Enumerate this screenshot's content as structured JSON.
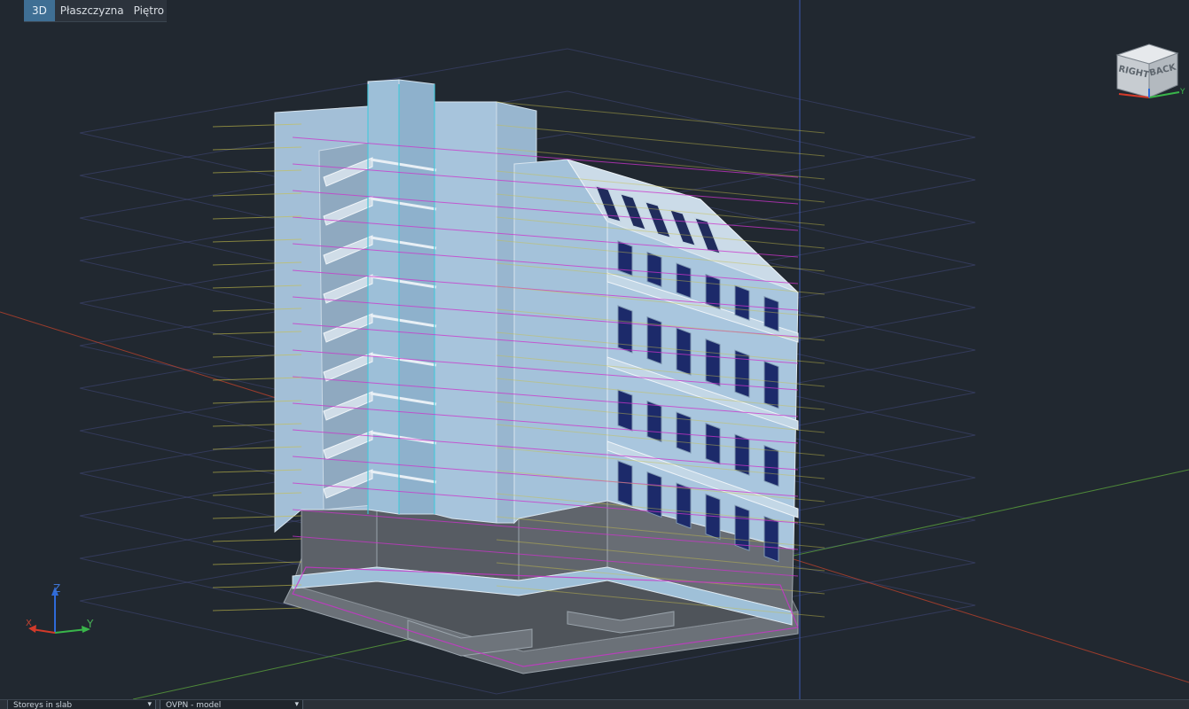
{
  "toolbar": {
    "view_3d": "3D",
    "plane": "Płaszczyzna",
    "floor": "Piętro"
  },
  "viewcube": {
    "face_right": "RIGHT",
    "face_back": "BACK",
    "axis_y": "Y"
  },
  "ucs": {
    "z": "Z",
    "y": "Y",
    "x": "X"
  },
  "colors": {
    "background": "#212830",
    "grid_lines": "#4a4f8c",
    "axis_x": "#b8412c",
    "axis_y": "#5aa03c",
    "axis_z": "#3e5fc0",
    "facade": "#a6c4de",
    "podium": "#5c6168",
    "magenta_edges": "#cc33cc",
    "yellow_edges": "#c8c04a"
  },
  "bottom_bar": {
    "dropdown1": "Storeys in slab",
    "dropdown2": "OVPN - model"
  }
}
